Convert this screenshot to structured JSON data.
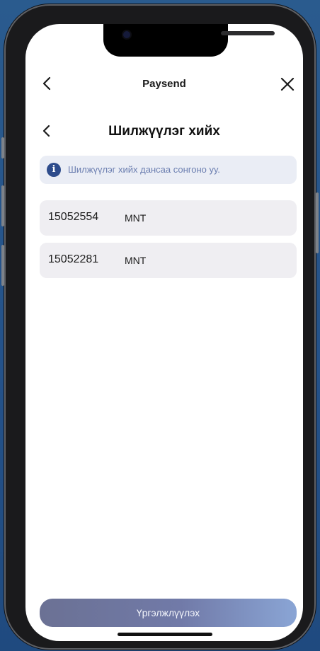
{
  "colors": {
    "background": "#2a5b8e",
    "screen": "#ffffff",
    "info_banner_bg": "#eaedf5",
    "info_icon": "#2e4c8c",
    "info_text": "#6b7eb0",
    "card_bg": "#efeef2",
    "button_gradient_start": "#6b7194",
    "button_gradient_end": "#8aa5d5"
  },
  "header": {
    "title": "Paysend",
    "back_icon": "chevron-left-icon",
    "close_icon": "close-icon"
  },
  "page": {
    "title": "Шилжүүлэг хийх",
    "back_icon": "chevron-left-icon"
  },
  "info": {
    "icon": "info-icon",
    "icon_glyph": "i",
    "text": "Шилжүүлэг хийх дансаа сонгоно уу."
  },
  "accounts": [
    {
      "number": "15052554",
      "currency": "MNT"
    },
    {
      "number": "15052281",
      "currency": "MNT"
    }
  ],
  "footer": {
    "continue_label": "Үргэлжлүүлэх"
  }
}
